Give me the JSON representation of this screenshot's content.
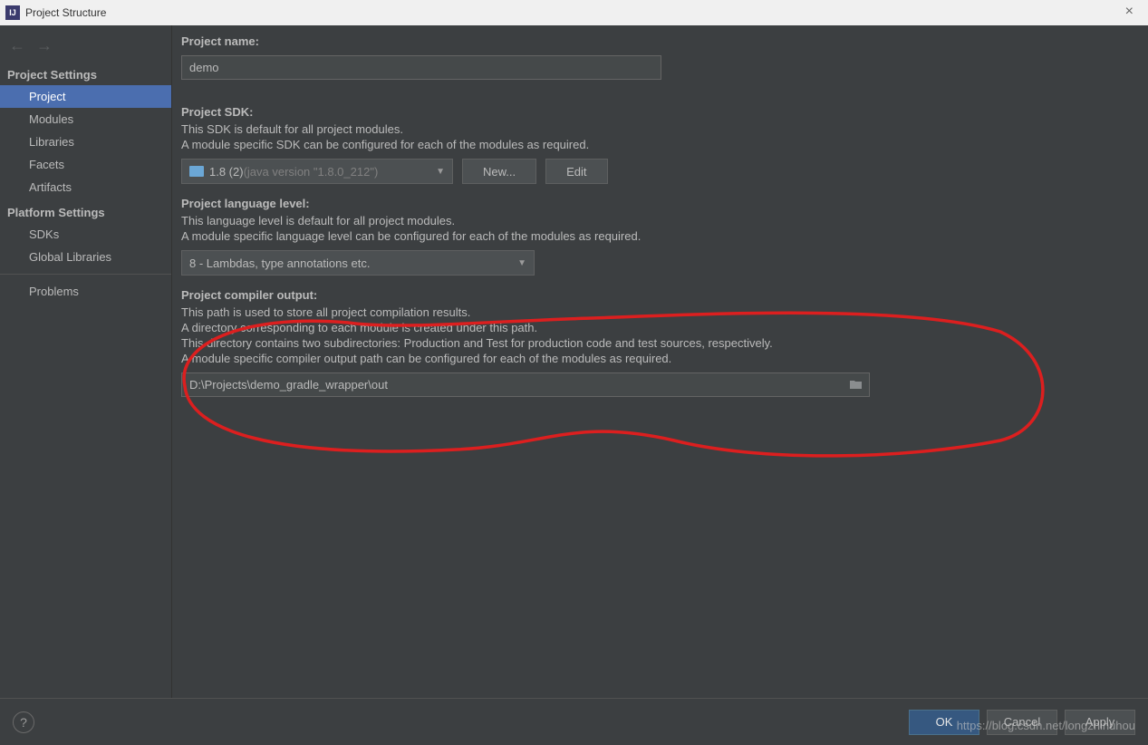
{
  "window": {
    "title": "Project Structure",
    "app_icon_text": "IJ"
  },
  "sidebar": {
    "sections": {
      "project_settings": "Project Settings",
      "platform_settings": "Platform Settings"
    },
    "items": {
      "project": "Project",
      "modules": "Modules",
      "libraries": "Libraries",
      "facets": "Facets",
      "artifacts": "Artifacts",
      "sdks": "SDKs",
      "global_libraries": "Global Libraries",
      "problems": "Problems"
    }
  },
  "main": {
    "project_name": {
      "label": "Project name:",
      "value": "demo"
    },
    "project_sdk": {
      "label": "Project SDK:",
      "desc1": "This SDK is default for all project modules.",
      "desc2": "A module specific SDK can be configured for each of the modules as required.",
      "value": "1.8 (2)",
      "value_suffix": " (java version \"1.8.0_212\")",
      "new_btn": "New...",
      "edit_btn": "Edit"
    },
    "language_level": {
      "label": "Project language level:",
      "desc1": "This language level is default for all project modules.",
      "desc2": "A module specific language level can be configured for each of the modules as required.",
      "value": "8 - Lambdas, type annotations etc."
    },
    "compiler_output": {
      "label": "Project compiler output:",
      "desc1": "This path is used to store all project compilation results.",
      "desc2": "A directory corresponding to each module is created under this path.",
      "desc3": "This directory contains two subdirectories: Production and Test for production code and test sources, respectively.",
      "desc4": "A module specific compiler output path can be configured for each of the modules as required.",
      "value": "D:\\Projects\\demo_gradle_wrapper\\out"
    }
  },
  "buttons": {
    "ok": "OK",
    "cancel": "Cancel",
    "apply": "Apply",
    "help": "?"
  },
  "watermark": "https://blog.csdn.net/longzhinuhou"
}
